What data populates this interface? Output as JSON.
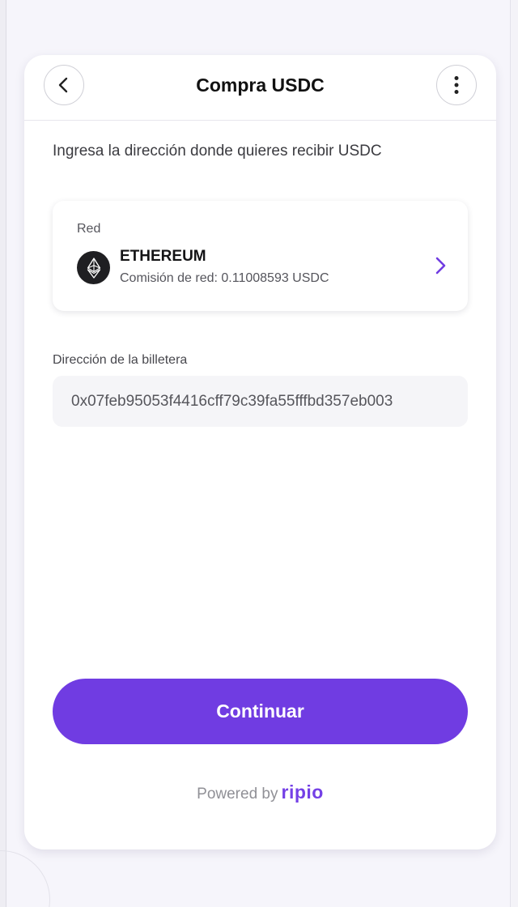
{
  "header": {
    "title": "Compra USDC",
    "back_icon": "chevron-left-icon",
    "more_icon": "more-vertical-icon"
  },
  "instruction": "Ingresa la dirección donde quieres recibir USDC",
  "network": {
    "label": "Red",
    "name": "ETHEREUM",
    "fee": "Comisión de red: 0.11008593 USDC",
    "icon": "ethereum-icon"
  },
  "wallet": {
    "label": "Dirección de la billetera",
    "value": "0x07feb95053f4416cff79c39fa55fffbd357eb003"
  },
  "continue_label": "Continuar",
  "footer": {
    "powered_by": "Powered by",
    "brand": "ripio"
  },
  "colors": {
    "accent": "#703ce2",
    "brand": "#7440e6"
  }
}
